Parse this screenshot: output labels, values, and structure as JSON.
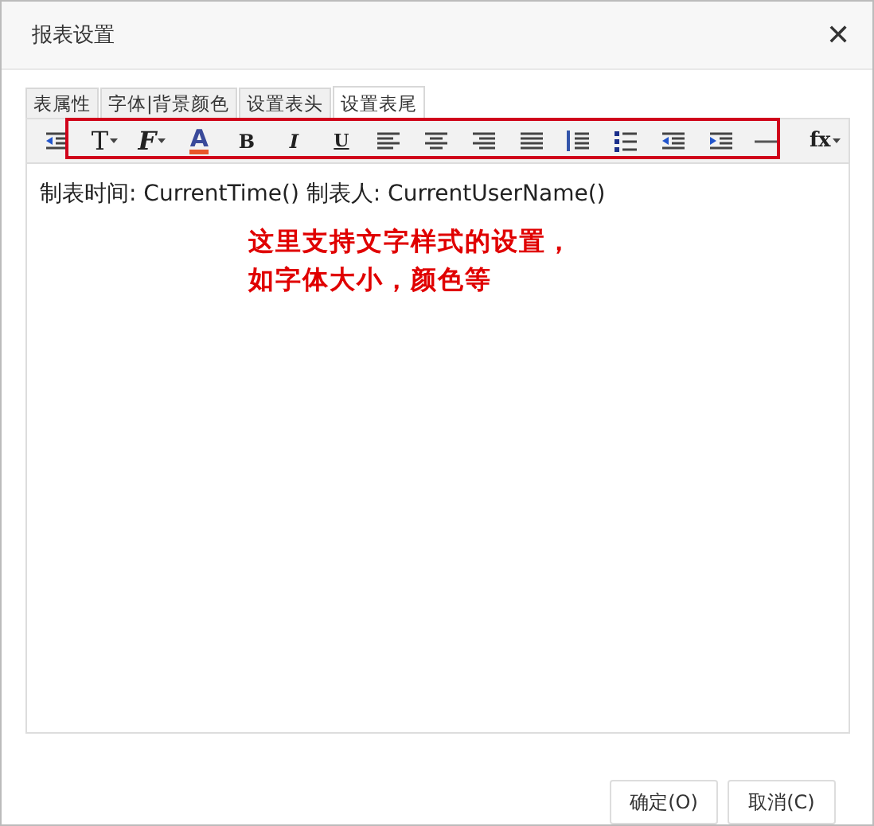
{
  "window": {
    "title": "报表设置",
    "close": "✕"
  },
  "tabs": [
    {
      "label": "表属性",
      "selected": false
    },
    {
      "label": "字体|背景颜色",
      "selected": false
    },
    {
      "label": "设置表头",
      "selected": false
    },
    {
      "label": "设置表尾",
      "selected": true
    }
  ],
  "toolbar": [
    {
      "kind": "indent-first"
    },
    {
      "kind": "serif",
      "label": "T",
      "dropdown": true
    },
    {
      "kind": "script",
      "label": "F",
      "dropdown": true
    },
    {
      "kind": "color-a",
      "label": "A"
    },
    {
      "kind": "bold",
      "label": "B"
    },
    {
      "kind": "italic",
      "label": "I"
    },
    {
      "kind": "underline",
      "label": "U"
    },
    {
      "kind": "align-left"
    },
    {
      "kind": "align-center"
    },
    {
      "kind": "align-right"
    },
    {
      "kind": "align-justify"
    },
    {
      "kind": "ordered-list"
    },
    {
      "kind": "bullet-list"
    },
    {
      "kind": "outdent"
    },
    {
      "kind": "indent"
    },
    {
      "kind": "rule"
    },
    {
      "kind": "fx",
      "label": "fx",
      "dropdown": true
    }
  ],
  "editor": {
    "text": "制表时间: CurrentTime() 制表人: CurrentUserName()"
  },
  "annotation": {
    "lines": [
      "这里支持文字样式的设置，",
      "如字体大小，颜色等"
    ]
  },
  "buttons": [
    "确定(O)",
    "取消(C)"
  ]
}
